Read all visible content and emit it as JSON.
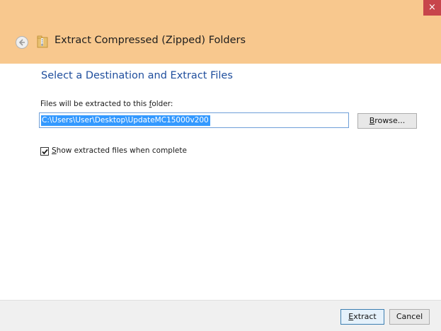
{
  "window": {
    "close_glyph": "×",
    "accent_color": "#f8c88e",
    "close_color": "#c7454b"
  },
  "header": {
    "back_icon": "back-arrow-icon",
    "app_icon": "zip-folder-icon",
    "title": "Extract Compressed (Zipped) Folders"
  },
  "main": {
    "title": "Select a Destination and Extract Files",
    "folder_label_pre": "Files will be extracted to this ",
    "folder_label_key": "f",
    "folder_label_post": "older:",
    "path_value": "C:\\Users\\User\\Desktop\\UpdateMC15000v200",
    "browse_key": "B",
    "browse_rest": "rowse...",
    "checkbox_checked": true,
    "checkbox_pre": "",
    "checkbox_key": "S",
    "checkbox_post": "how extracted files when complete"
  },
  "footer": {
    "extract_key": "E",
    "extract_rest": "xtract",
    "cancel_label": "Cancel"
  }
}
